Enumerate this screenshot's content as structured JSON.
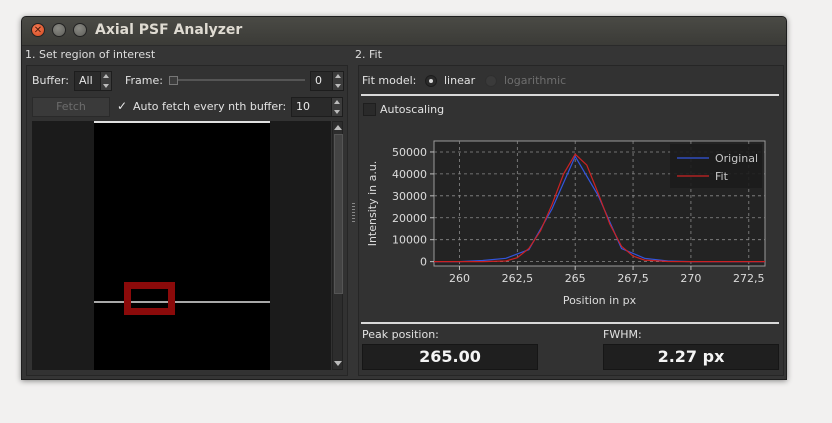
{
  "window": {
    "title": "Axial PSF Analyzer"
  },
  "roi": {
    "group_title": "1. Set region of interest",
    "buffer_label": "Buffer:",
    "buffer_value": "All",
    "frame_label": "Frame:",
    "frame_value": "0",
    "fetch_label": "Fetch",
    "auto_fetch_label": "Auto fetch every nth buffer:",
    "auto_fetch_checked": true,
    "auto_fetch_value": "10"
  },
  "fit": {
    "group_title": "2. Fit",
    "fit_model_label": "Fit model:",
    "options": [
      "linear",
      "logarithmic"
    ],
    "selected": "linear",
    "autoscaling_label": "Autoscaling",
    "autoscaling_checked": false,
    "peak_label": "Peak position:",
    "peak_value": "265.00",
    "fwhm_label": "FWHM:",
    "fwhm_value": "2.27 px"
  },
  "chart_data": {
    "type": "line",
    "xlabel": "Position in px",
    "ylabel": "Intensity in a.u.",
    "xlim": [
      258.9,
      273.2
    ],
    "ylim": [
      -2000,
      55000
    ],
    "xticks": [
      260,
      262.5,
      265,
      267.5,
      270,
      272.5
    ],
    "xtick_labels": [
      "260",
      "262,5",
      "265",
      "267,5",
      "270",
      "272,5"
    ],
    "yticks": [
      0,
      10000,
      20000,
      30000,
      40000,
      50000
    ],
    "ytick_labels": [
      "0",
      "10000",
      "20000",
      "30000",
      "40000",
      "50000"
    ],
    "grid": true,
    "legend_position": "top-right",
    "series": [
      {
        "name": "Original",
        "color": "#3355dd",
        "x": [
          258.9,
          260,
          261,
          262,
          263,
          264,
          265,
          266,
          267,
          268,
          269,
          270,
          271,
          272,
          273.2
        ],
        "y": [
          0,
          0,
          500,
          1500,
          5500,
          24000,
          48000,
          30000,
          6000,
          1500,
          300,
          0,
          0,
          0,
          0
        ]
      },
      {
        "name": "Fit",
        "color": "#cc2222",
        "x": [
          258.9,
          260,
          261,
          262,
          262.5,
          263,
          263.5,
          264,
          264.5,
          265,
          265.5,
          266,
          266.5,
          267,
          267.5,
          268,
          269,
          270,
          272,
          273.2
        ],
        "y": [
          0,
          0,
          0,
          300,
          1800,
          6000,
          14000,
          26000,
          40000,
          49000,
          44000,
          31000,
          17000,
          7000,
          2500,
          700,
          50,
          0,
          0,
          0
        ]
      }
    ]
  }
}
